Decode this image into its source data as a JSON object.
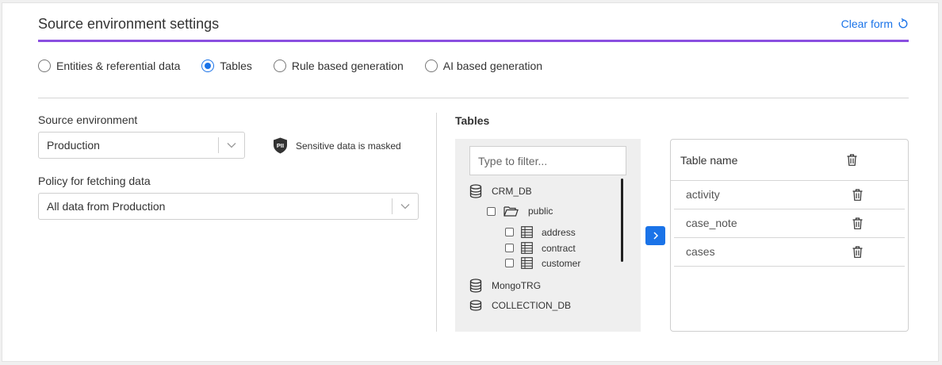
{
  "header": {
    "title": "Source environment settings",
    "clear_form_label": "Clear form"
  },
  "modes": [
    {
      "label": "Entities & referential data",
      "selected": false
    },
    {
      "label": "Tables",
      "selected": true
    },
    {
      "label": "Rule based generation",
      "selected": false
    },
    {
      "label": "AI based generation",
      "selected": false
    }
  ],
  "source": {
    "label": "Source environment",
    "value": "Production",
    "pii_badge": "PII",
    "pii_note": "Sensitive data is masked"
  },
  "policy": {
    "label": "Policy for fetching data",
    "value": "All data from Production"
  },
  "tables_panel": {
    "heading": "Tables",
    "filter_placeholder": "Type to filter...",
    "tree": {
      "crm_db": "CRM_DB",
      "schema": "public",
      "tables": [
        "address",
        "contract",
        "customer"
      ],
      "mongo": "MongoTRG",
      "collection": "COLLECTION_DB"
    }
  },
  "selected_tables": {
    "header": "Table name",
    "rows": [
      "activity",
      "case_note",
      "cases"
    ]
  },
  "colors": {
    "accent": "#8a4fe0",
    "primary": "#1a73e8"
  }
}
